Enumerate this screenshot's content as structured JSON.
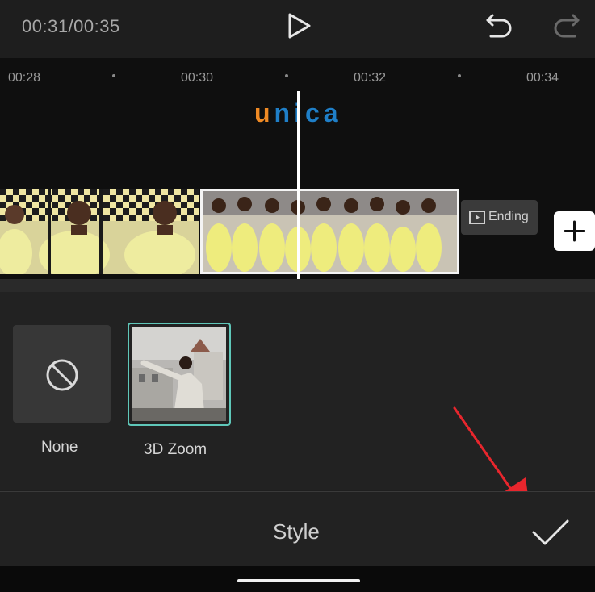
{
  "header": {
    "time_display": "00:31/00:35",
    "play_icon": "play-icon",
    "undo_icon": "undo-icon",
    "redo_icon": "redo-icon"
  },
  "timeline": {
    "ruler_labels": [
      "00:28",
      "00:30",
      "00:32",
      "00:34"
    ],
    "watermark": {
      "first_letter": "u",
      "rest": "nica",
      "colors": {
        "first": "#f08a24",
        "rest": "#1f7fc8"
      }
    },
    "ending_label": "Ending",
    "ending_icon": "play-square-icon",
    "add_icon": "plus-icon"
  },
  "effects": {
    "items": [
      {
        "label": "None",
        "icon": "no-symbol-icon"
      },
      {
        "label": "3D Zoom",
        "selected": true
      }
    ],
    "selected_border_color": "#5fc7b9"
  },
  "footer": {
    "title": "Style",
    "confirm_icon": "checkmark-icon"
  },
  "annotation": {
    "arrow_color": "#e8262d"
  }
}
